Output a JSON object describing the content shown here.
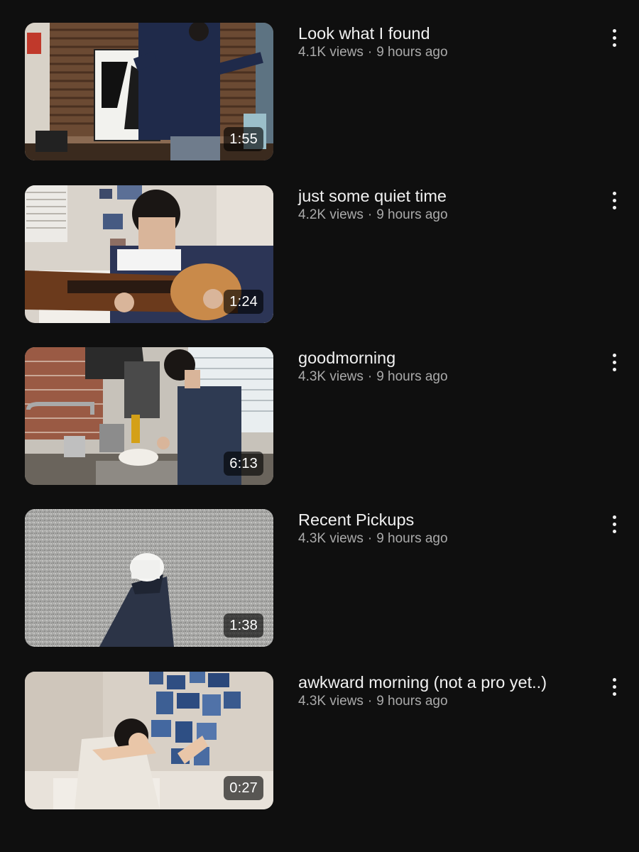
{
  "videos": [
    {
      "title": "Look what I found",
      "views": "4.1K views",
      "age": "9 hours ago",
      "duration": "1:55",
      "menu_icon": "more-vert-icon"
    },
    {
      "title": "just some quiet time",
      "views": "4.2K views",
      "age": "9 hours ago",
      "duration": "1:24",
      "menu_icon": "more-vert-icon"
    },
    {
      "title": "goodmorning",
      "views": "4.3K views",
      "age": "9 hours ago",
      "duration": "6:13",
      "menu_icon": "more-vert-icon"
    },
    {
      "title": "Recent Pickups",
      "views": "4.3K views",
      "age": "9 hours ago",
      "duration": "1:38",
      "menu_icon": "more-vert-icon"
    },
    {
      "title": "awkward morning (not a pro yet..)",
      "views": "4.3K views",
      "age": "9 hours ago",
      "duration": "0:27",
      "menu_icon": "more-vert-icon"
    }
  ],
  "colors": {
    "background": "#0f0f0f",
    "title_text": "#f1f1f1",
    "secondary_text": "#aaaaaa",
    "duration_badge": "rgba(0,0,0,0.62)"
  }
}
